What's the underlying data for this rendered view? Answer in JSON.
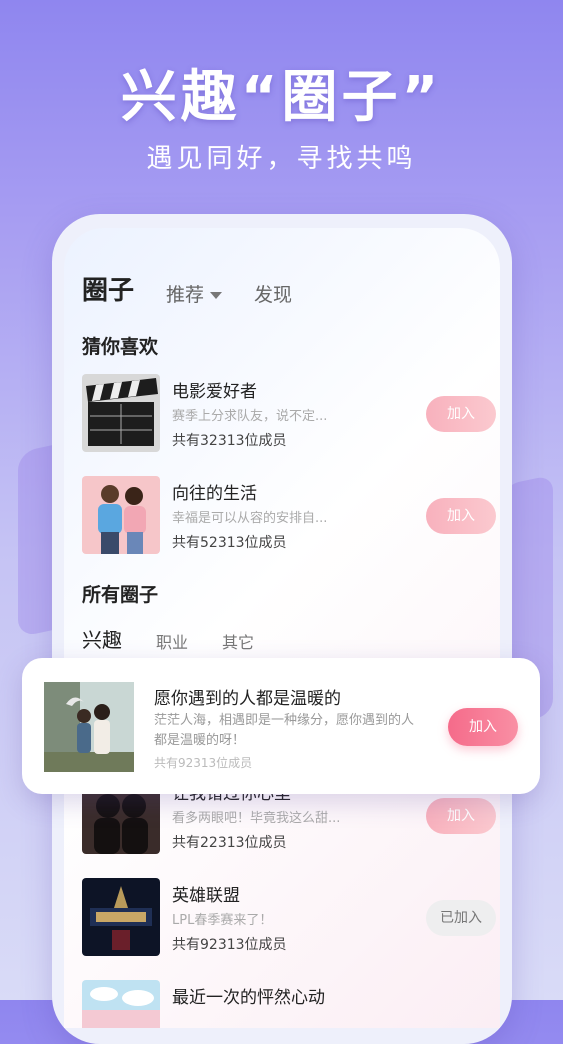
{
  "headline": "兴趣“圈子”",
  "subheadline": "遇见同好，寻找共鸣",
  "tabs": {
    "main": "圈子",
    "recommend": "推荐",
    "discover": "发现"
  },
  "sections": {
    "guess": "猜你喜欢",
    "all": "所有圈子"
  },
  "recommended": [
    {
      "title": "电影爱好者",
      "desc": "赛季上分求队友，说不定...",
      "members": "共有32313位成员",
      "action": "加入"
    },
    {
      "title": "向往的生活",
      "desc": "幸福是可以从容的安排自...",
      "members": "共有52313位成员",
      "action": "加入"
    }
  ],
  "sub_tabs": [
    "兴趣",
    "职业",
    "其它"
  ],
  "all_circles": [
    {
      "title": "让我错过你心里",
      "desc": "看多两眼吧！毕竟我这么甜...",
      "members": "共有22313位成员",
      "action": "加入"
    },
    {
      "title": "英雄联盟",
      "desc": "LPL春季赛来了！",
      "members": "共有92313位成员",
      "action": "已加入"
    },
    {
      "title": "最近一次的怦然心动",
      "desc": "",
      "members": "",
      "action": ""
    }
  ],
  "popup": {
    "title": "愿你遇到的人都是温暖的",
    "desc": "茫茫人海，相遇即是一种缘分，愿你遇到的人都是温暖的呀！",
    "members": "共有92313位成员",
    "action": "加入"
  },
  "colors": {
    "accent": "#f56b8a",
    "bg_top": "#8f86ef",
    "join_soft": "#f8b1bd"
  }
}
